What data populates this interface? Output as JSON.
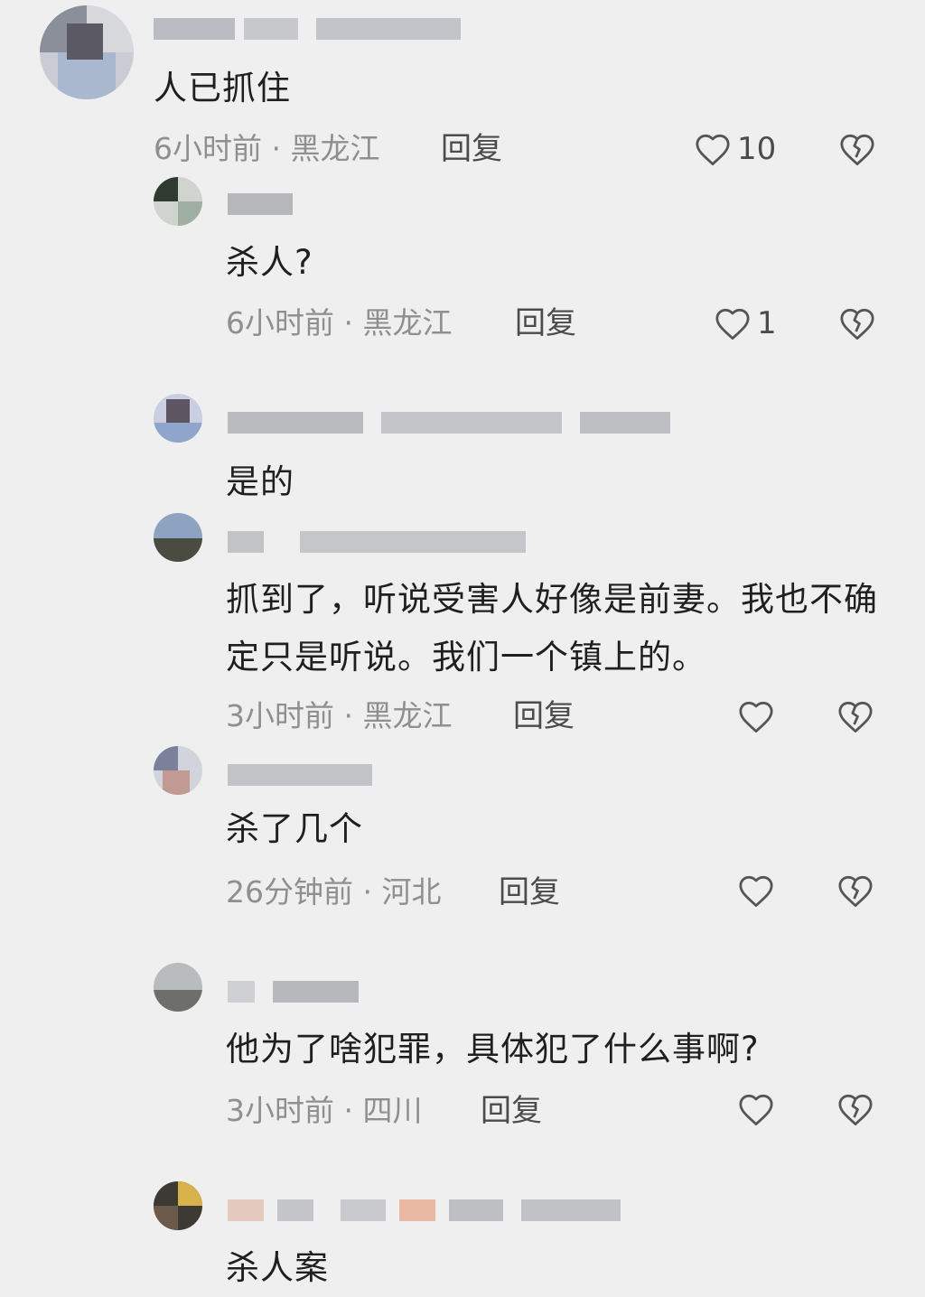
{
  "icons": {
    "like": "heart-outline-icon",
    "dislike": "broken-heart-icon"
  },
  "colors": {
    "background": "#efefef",
    "text": "#1f1f1f",
    "meta": "#8f8f8f",
    "action": "#4b4b4b"
  },
  "comments": [
    {
      "text": "人已抓住",
      "time": "6小时前",
      "location": "黑龙江",
      "reply_label": "回复",
      "like_count": "10"
    },
    {
      "text": "杀人?",
      "time": "6小时前",
      "location": "黑龙江",
      "reply_label": "回复",
      "like_count": "1"
    },
    {
      "text": "是的"
    },
    {
      "text": "抓到了，听说受害人好像是前妻。我也不确定只是听说。我们一个镇上的。",
      "time": "3小时前",
      "location": "黑龙江",
      "reply_label": "回复"
    },
    {
      "text": "杀了几个",
      "time": "26分钟前",
      "location": "河北",
      "reply_label": "回复"
    },
    {
      "text": "他为了啥犯罪，具体犯了什么事啊?",
      "time": "3小时前",
      "location": "四川",
      "reply_label": "回复"
    },
    {
      "text": "杀人案"
    }
  ]
}
